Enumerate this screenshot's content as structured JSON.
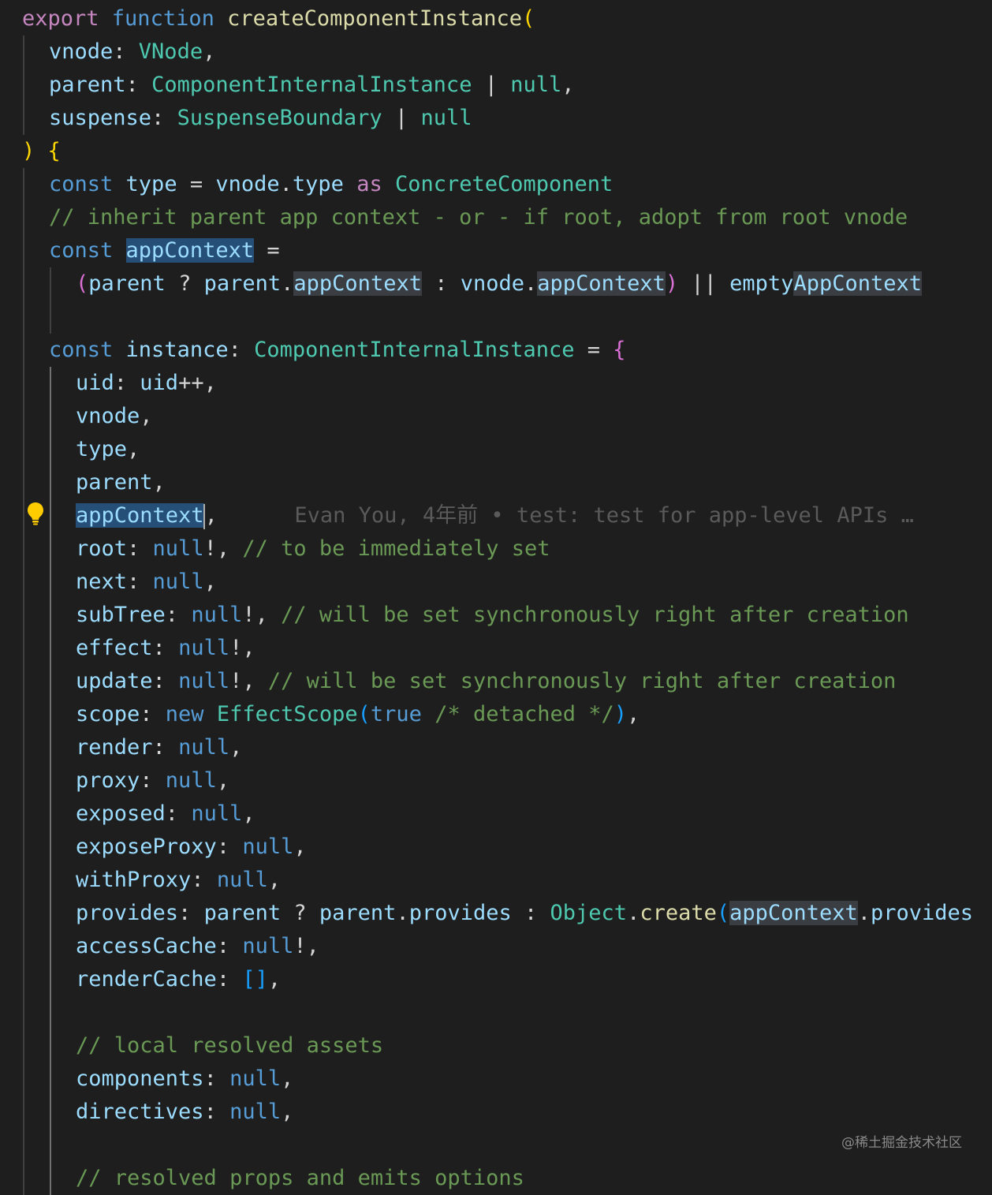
{
  "editor": {
    "lines": [
      {
        "indent": 0,
        "guides": [],
        "tokens": [
          [
            "export ",
            "kw"
          ],
          [
            "function ",
            "st"
          ],
          [
            "createComponentInstance",
            "fn"
          ],
          [
            "(",
            "br"
          ]
        ]
      },
      {
        "indent": 1,
        "guides": [
          1
        ],
        "tokens": [
          [
            "vnode",
            "vr"
          ],
          [
            ": ",
            "pu"
          ],
          [
            "VNode",
            "ty"
          ],
          [
            ",",
            "pu"
          ]
        ]
      },
      {
        "indent": 1,
        "guides": [
          1
        ],
        "tokens": [
          [
            "parent",
            "vr"
          ],
          [
            ": ",
            "pu"
          ],
          [
            "ComponentInternalInstance",
            "ty"
          ],
          [
            " | ",
            "pu"
          ],
          [
            "null",
            "ty"
          ],
          [
            ",",
            "pu"
          ]
        ]
      },
      {
        "indent": 1,
        "guides": [
          1
        ],
        "tokens": [
          [
            "suspense",
            "vr"
          ],
          [
            ": ",
            "pu"
          ],
          [
            "SuspenseBoundary",
            "ty"
          ],
          [
            " | ",
            "pu"
          ],
          [
            "null",
            "ty"
          ]
        ]
      },
      {
        "indent": 0,
        "guides": [],
        "tokens": [
          [
            ")",
            "br"
          ],
          [
            " ",
            "pu"
          ],
          [
            "{",
            "br"
          ]
        ]
      },
      {
        "indent": 1,
        "guides": [
          1
        ],
        "tokens": [
          [
            "const ",
            "st"
          ],
          [
            "type",
            "vr"
          ],
          [
            " = ",
            "pu"
          ],
          [
            "vnode",
            "vr"
          ],
          [
            ".",
            "pu"
          ],
          [
            "type",
            "vr"
          ],
          [
            " as ",
            "kw"
          ],
          [
            "ConcreteComponent",
            "ty"
          ]
        ]
      },
      {
        "indent": 1,
        "guides": [
          1
        ],
        "tokens": [
          [
            "// inherit parent app context - or - if root, adopt from root vnode",
            "cm"
          ]
        ]
      },
      {
        "indent": 1,
        "guides": [
          1
        ],
        "tokens": [
          [
            "const ",
            "st"
          ],
          [
            "appContext",
            "vr",
            "hl"
          ],
          [
            " =",
            "pu"
          ]
        ]
      },
      {
        "indent": 2,
        "guides": [
          1,
          2
        ],
        "tokens": [
          [
            "(",
            "br2"
          ],
          [
            "parent",
            "vr"
          ],
          [
            " ? ",
            "pu"
          ],
          [
            "parent",
            "vr"
          ],
          [
            ".",
            "pu"
          ],
          [
            "appContext",
            "vr",
            "hl2"
          ],
          [
            " : ",
            "pu"
          ],
          [
            "vnode",
            "vr"
          ],
          [
            ".",
            "pu"
          ],
          [
            "appContext",
            "vr",
            "hl2"
          ],
          [
            ")",
            "br2"
          ],
          [
            " || ",
            "pu"
          ],
          [
            "empty",
            "vr"
          ],
          [
            "AppContext",
            "vr",
            "hl2"
          ]
        ]
      },
      {
        "indent": 2,
        "guides": [
          1,
          2
        ],
        "tokens": []
      },
      {
        "indent": 1,
        "guides": [
          1
        ],
        "tokens": [
          [
            "const ",
            "st"
          ],
          [
            "instance",
            "vr"
          ],
          [
            ": ",
            "pu"
          ],
          [
            "ComponentInternalInstance",
            "ty"
          ],
          [
            " = ",
            "pu"
          ],
          [
            "{",
            "br2"
          ]
        ]
      },
      {
        "indent": 2,
        "guides": [
          1,
          2
        ],
        "tokens": [
          [
            "uid",
            "vr"
          ],
          [
            ": ",
            "pu"
          ],
          [
            "uid",
            "vr"
          ],
          [
            "++,",
            "pu"
          ]
        ]
      },
      {
        "indent": 2,
        "guides": [
          1,
          2
        ],
        "tokens": [
          [
            "vnode",
            "vr"
          ],
          [
            ",",
            "pu"
          ]
        ]
      },
      {
        "indent": 2,
        "guides": [
          1,
          2
        ],
        "tokens": [
          [
            "type",
            "vr"
          ],
          [
            ",",
            "pu"
          ]
        ]
      },
      {
        "indent": 2,
        "guides": [
          1,
          2
        ],
        "tokens": [
          [
            "parent",
            "vr"
          ],
          [
            ",",
            "pu"
          ]
        ]
      },
      {
        "indent": 2,
        "guides": [
          1,
          2
        ],
        "cursor": true,
        "tokens": [
          [
            "appContext",
            "vr",
            "hl"
          ],
          [
            ",",
            "pu"
          ]
        ],
        "blame": "      Evan You, 4年前 • test: test for app-level APIs …"
      },
      {
        "indent": 2,
        "guides": [
          1,
          2
        ],
        "tokens": [
          [
            "root",
            "vr"
          ],
          [
            ": ",
            "pu"
          ],
          [
            "null",
            "st"
          ],
          [
            "!, ",
            "pu"
          ],
          [
            "// to be immediately set",
            "cm"
          ]
        ]
      },
      {
        "indent": 2,
        "guides": [
          1,
          2
        ],
        "tokens": [
          [
            "next",
            "vr"
          ],
          [
            ": ",
            "pu"
          ],
          [
            "null",
            "st"
          ],
          [
            ",",
            "pu"
          ]
        ]
      },
      {
        "indent": 2,
        "guides": [
          1,
          2
        ],
        "tokens": [
          [
            "subTree",
            "vr"
          ],
          [
            ": ",
            "pu"
          ],
          [
            "null",
            "st"
          ],
          [
            "!, ",
            "pu"
          ],
          [
            "// will be set synchronously right after creation",
            "cm"
          ]
        ]
      },
      {
        "indent": 2,
        "guides": [
          1,
          2
        ],
        "tokens": [
          [
            "effect",
            "vr"
          ],
          [
            ": ",
            "pu"
          ],
          [
            "null",
            "st"
          ],
          [
            "!,",
            "pu"
          ]
        ]
      },
      {
        "indent": 2,
        "guides": [
          1,
          2
        ],
        "tokens": [
          [
            "update",
            "vr"
          ],
          [
            ": ",
            "pu"
          ],
          [
            "null",
            "st"
          ],
          [
            "!, ",
            "pu"
          ],
          [
            "// will be set synchronously right after creation",
            "cm"
          ]
        ]
      },
      {
        "indent": 2,
        "guides": [
          1,
          2
        ],
        "tokens": [
          [
            "scope",
            "vr"
          ],
          [
            ": ",
            "pu"
          ],
          [
            "new ",
            "st"
          ],
          [
            "EffectScope",
            "ty"
          ],
          [
            "(",
            "br3"
          ],
          [
            "true",
            "st"
          ],
          [
            " /* detached */",
            "cm"
          ],
          [
            ")",
            "br3"
          ],
          [
            ",",
            "pu"
          ]
        ]
      },
      {
        "indent": 2,
        "guides": [
          1,
          2
        ],
        "tokens": [
          [
            "render",
            "vr"
          ],
          [
            ": ",
            "pu"
          ],
          [
            "null",
            "st"
          ],
          [
            ",",
            "pu"
          ]
        ]
      },
      {
        "indent": 2,
        "guides": [
          1,
          2
        ],
        "tokens": [
          [
            "proxy",
            "vr"
          ],
          [
            ": ",
            "pu"
          ],
          [
            "null",
            "st"
          ],
          [
            ",",
            "pu"
          ]
        ]
      },
      {
        "indent": 2,
        "guides": [
          1,
          2
        ],
        "tokens": [
          [
            "exposed",
            "vr"
          ],
          [
            ": ",
            "pu"
          ],
          [
            "null",
            "st"
          ],
          [
            ",",
            "pu"
          ]
        ]
      },
      {
        "indent": 2,
        "guides": [
          1,
          2
        ],
        "tokens": [
          [
            "exposeProxy",
            "vr"
          ],
          [
            ": ",
            "pu"
          ],
          [
            "null",
            "st"
          ],
          [
            ",",
            "pu"
          ]
        ]
      },
      {
        "indent": 2,
        "guides": [
          1,
          2
        ],
        "tokens": [
          [
            "withProxy",
            "vr"
          ],
          [
            ": ",
            "pu"
          ],
          [
            "null",
            "st"
          ],
          [
            ",",
            "pu"
          ]
        ]
      },
      {
        "indent": 2,
        "guides": [
          1,
          2
        ],
        "tokens": [
          [
            "provides",
            "vr"
          ],
          [
            ": ",
            "pu"
          ],
          [
            "parent",
            "vr"
          ],
          [
            " ? ",
            "pu"
          ],
          [
            "parent",
            "vr"
          ],
          [
            ".",
            "pu"
          ],
          [
            "provides",
            "vr"
          ],
          [
            " : ",
            "pu"
          ],
          [
            "Object",
            "ty"
          ],
          [
            ".",
            "pu"
          ],
          [
            "create",
            "fn"
          ],
          [
            "(",
            "br3"
          ],
          [
            "appContext",
            "vr",
            "hl2"
          ],
          [
            ".",
            "pu"
          ],
          [
            "provides",
            "vr"
          ]
        ]
      },
      {
        "indent": 2,
        "guides": [
          1,
          2
        ],
        "tokens": [
          [
            "accessCache",
            "vr"
          ],
          [
            ": ",
            "pu"
          ],
          [
            "null",
            "st"
          ],
          [
            "!,",
            "pu"
          ]
        ]
      },
      {
        "indent": 2,
        "guides": [
          1,
          2
        ],
        "tokens": [
          [
            "renderCache",
            "vr"
          ],
          [
            ": ",
            "pu"
          ],
          [
            "[]",
            "br3"
          ],
          [
            ",",
            "pu"
          ]
        ]
      },
      {
        "indent": 2,
        "guides": [
          1,
          2
        ],
        "tokens": []
      },
      {
        "indent": 2,
        "guides": [
          1,
          2
        ],
        "tokens": [
          [
            "// local resolved assets",
            "cm"
          ]
        ]
      },
      {
        "indent": 2,
        "guides": [
          1,
          2
        ],
        "tokens": [
          [
            "components",
            "vr"
          ],
          [
            ": ",
            "pu"
          ],
          [
            "null",
            "st"
          ],
          [
            ",",
            "pu"
          ]
        ]
      },
      {
        "indent": 2,
        "guides": [
          1,
          2
        ],
        "tokens": [
          [
            "directives",
            "vr"
          ],
          [
            ": ",
            "pu"
          ],
          [
            "null",
            "st"
          ],
          [
            ",",
            "pu"
          ]
        ]
      },
      {
        "indent": 2,
        "guides": [
          1,
          2
        ],
        "tokens": []
      },
      {
        "indent": 2,
        "guides": [
          1,
          2
        ],
        "tokens": [
          [
            "// resolved props and emits options",
            "cm"
          ]
        ]
      }
    ]
  },
  "gutter": {
    "lightbulb_icon": "lightbulb-icon"
  },
  "watermark": {
    "text": "@稀土掘金技术社区"
  }
}
